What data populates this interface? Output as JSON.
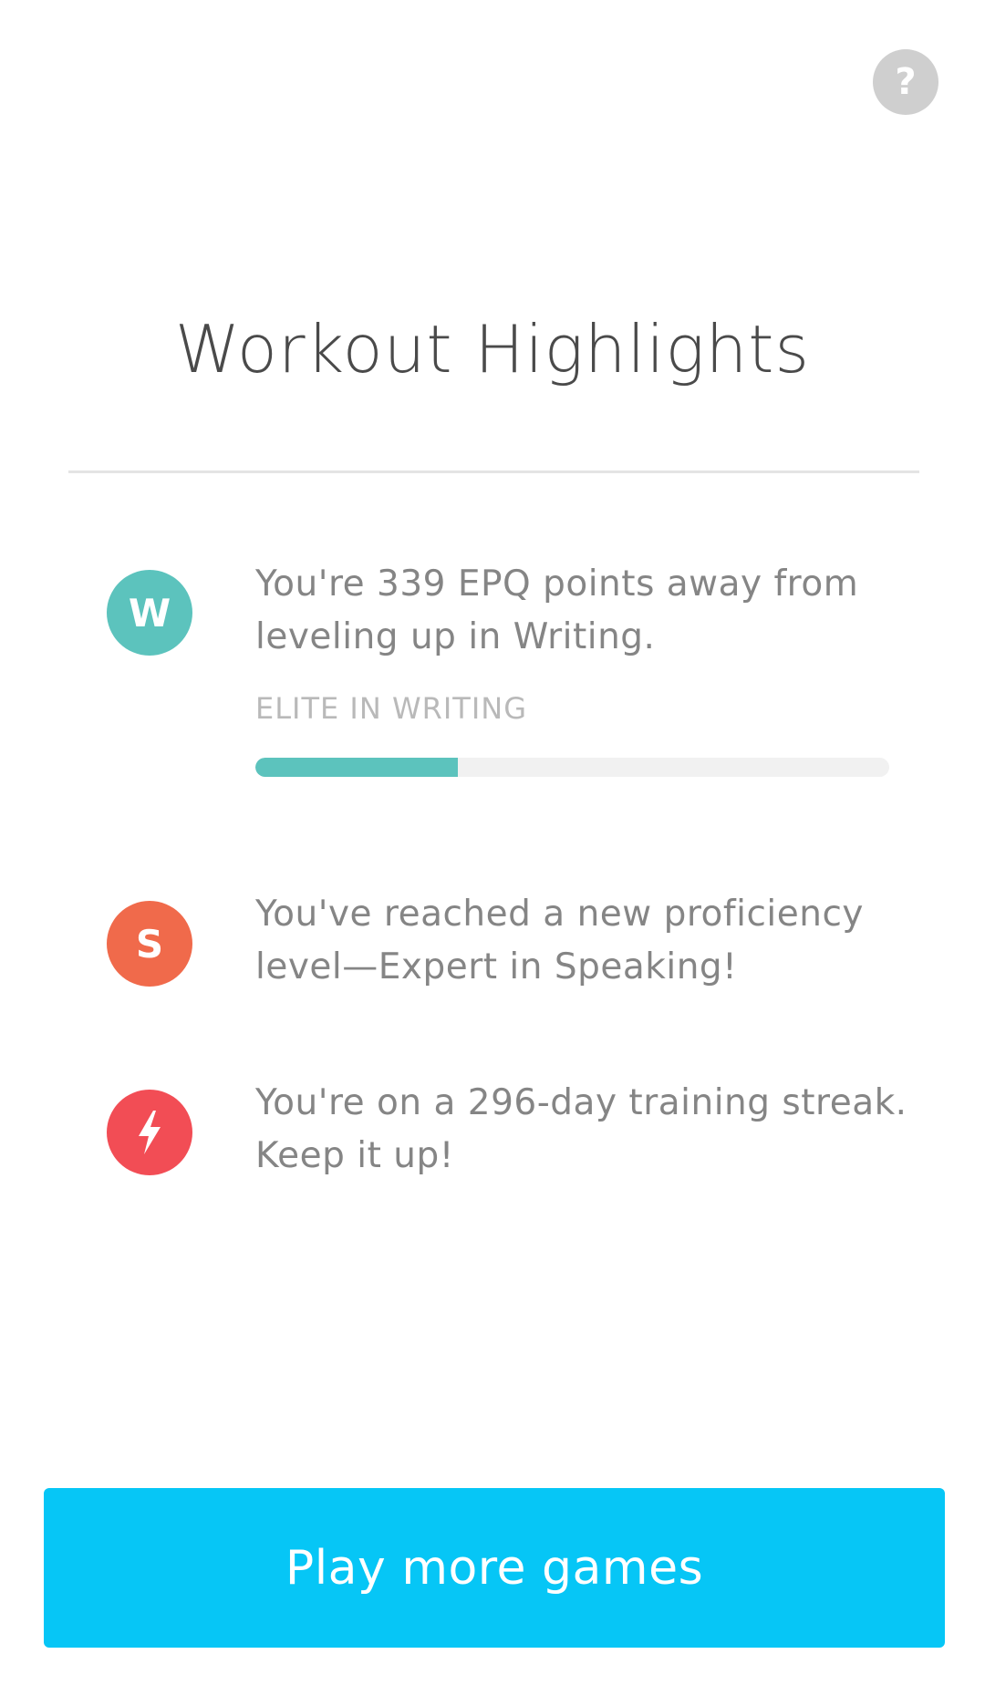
{
  "header": {
    "help_icon": "question-mark-icon",
    "help_glyph": "?",
    "title": "Workout Highlights"
  },
  "highlights": [
    {
      "badge_letter": "W",
      "badge_color": "#5cc3bd",
      "message": "You're 339 EPQ points away from leveling up in Writing.",
      "level_label": "ELITE IN WRITING",
      "progress_percent": 32
    },
    {
      "badge_letter": "S",
      "badge_color": "#f06a4b",
      "message": "You've reached a new proficiency level—Expert in Speaking!"
    },
    {
      "badge_icon": "lightning-bolt-icon",
      "badge_color": "#f24d55",
      "message": "You're on a 296-day training streak. Keep it up!"
    }
  ],
  "footer": {
    "cta_label": "Play more games",
    "cta_color": "#06c6f6"
  }
}
